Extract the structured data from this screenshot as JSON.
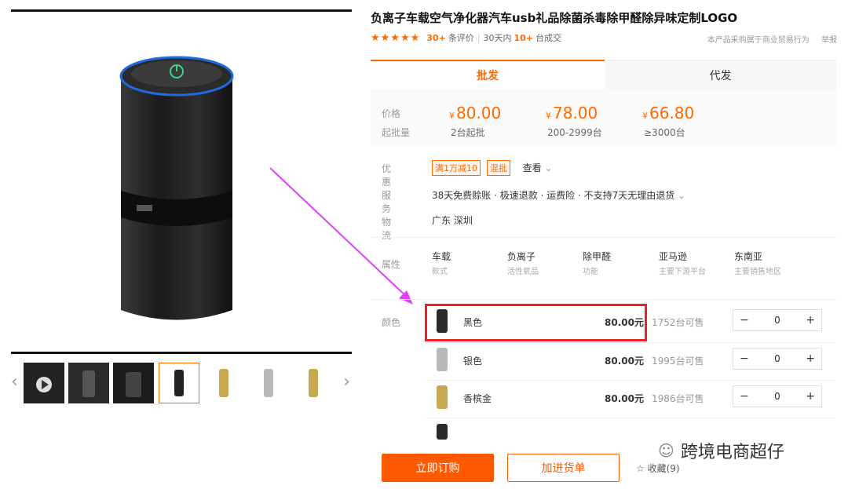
{
  "product": {
    "title": "负离子车载空气净化器汽车usb礼品除菌杀毒除甲醛除异味定制LOGO",
    "stars": "★★★★★",
    "reviews_count": "30+",
    "reviews_label": "条评价",
    "sold_prefix": "30天内",
    "sold_count": "10+",
    "sold_suffix": "台成交",
    "note": "本产品采购属于商业贸易行为",
    "report": "举报"
  },
  "tabs": [
    {
      "label": "批发"
    },
    {
      "label": "代发"
    }
  ],
  "pricing": {
    "price_label": "价格",
    "moq_label": "起批量",
    "currency": "¥",
    "tiers": [
      {
        "price": "80.00",
        "qty": "2台起批"
      },
      {
        "price": "78.00",
        "qty": "200-2999台"
      },
      {
        "price": "66.80",
        "qty": "≥3000台"
      }
    ]
  },
  "promo": {
    "label": "优惠",
    "tag1": "满1万减10",
    "tag2": "混批",
    "view": "查看"
  },
  "service": {
    "label": "服务",
    "text": "38天免费赊账 · 极速退款 · 运费险 · 不支持7天无理由退货"
  },
  "logistics": {
    "label": "物流",
    "text": "广东 深圳"
  },
  "attributes": {
    "label": "属性",
    "items": [
      {
        "value": "车载",
        "key": "款式"
      },
      {
        "value": "负离子",
        "key": "活性氧品"
      },
      {
        "value": "除甲醛",
        "key": "功能"
      },
      {
        "value": "亚马逊",
        "key": "主要下游平台"
      },
      {
        "value": "东南亚",
        "key": "主要销售地区"
      }
    ]
  },
  "color_label": "颜色",
  "skus": [
    {
      "name": "黑色",
      "price": "80.00元",
      "stock": "1752台可售",
      "qty": "0",
      "swatch": "#2b2b2b"
    },
    {
      "name": "银色",
      "price": "80.00元",
      "stock": "1995台可售",
      "qty": "0",
      "swatch": "#b9b9b9"
    },
    {
      "name": "香槟金",
      "price": "80.00元",
      "stock": "1986台可售",
      "qty": "0",
      "swatch": "#c9a94f"
    }
  ],
  "actions": {
    "order": "立即订购",
    "cart": "加进货单",
    "fav": "收藏(9)"
  },
  "watermark": "跨境电商超仔",
  "colors": {
    "accent": "#ff6a00",
    "highlight": "#e8242a",
    "arrow": "#e040fb"
  }
}
